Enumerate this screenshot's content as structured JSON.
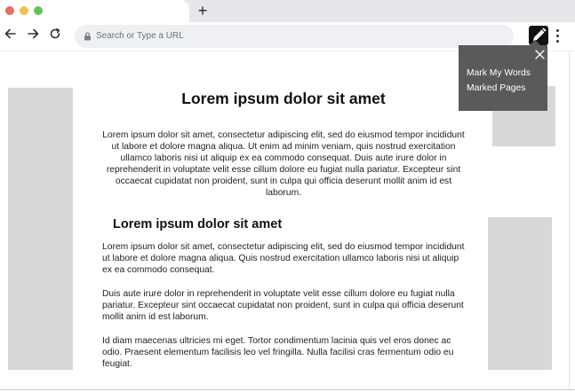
{
  "browser": {
    "traffic_lights": {
      "close_color": "#ec6a5e",
      "minimize_color": "#f4bf4f",
      "maximize_color": "#61c554"
    },
    "new_tab_label": "+",
    "nav": {
      "back_icon": "arrow-left-icon",
      "forward_icon": "arrow-right-icon",
      "reload_icon": "reload-icon"
    },
    "address_bar": {
      "placeholder": "Search or Type a URL",
      "icon": "lock-icon"
    },
    "extension_icon": "pencil-icon",
    "menu_icon": "kebab-menu-icon"
  },
  "popup": {
    "close_icon": "close-icon",
    "items": [
      "Mark My Words",
      "Marked Pages"
    ],
    "background": "#5a5a5a"
  },
  "article": {
    "title": "Lorem ipsum dolor sit amet",
    "intro": "Lorem ipsum dolor sit amet, consectetur adipiscing elit, sed do eiusmod tempor incididunt ut labore et dolore magna aliqua. Ut enim ad minim veniam, quis nostrud exercitation ullamco laboris nisi ut aliquip ex ea commodo consequat. Duis aute irure dolor in reprehenderit in voluptate velit esse cillum dolore eu fugiat nulla pariatur. Excepteur sint occaecat cupidatat non proident, sunt in culpa qui officia deserunt mollit anim id est laborum.",
    "subtitle": "Lorem ipsum dolor sit amet",
    "paragraphs": [
      "Lorem ipsum dolor sit amet, consectetur adipiscing elit, sed do eiusmod tempor incididunt ut labore et dolore magna aliqua. Quis nostrud exercitation ullamco laboris nisi ut aliquip ex ea commodo consequat.",
      "Duis aute irure dolor in reprehenderit in voluptate velit esse cillum dolore eu fugiat nulla pariatur. Excepteur sint occaecat cupidatat non proident, sunt in culpa qui officia deserunt mollit anim id est laborum.",
      "Id diam maecenas ultricies mi eget. Tortor condimentum lacinia quis vel eros donec ac odio. Praesent elementum facilisis leo vel fringilla. Nulla facilisi cras fermentum odio eu feugiat."
    ]
  },
  "placeholder_color": "#d8d8d8"
}
